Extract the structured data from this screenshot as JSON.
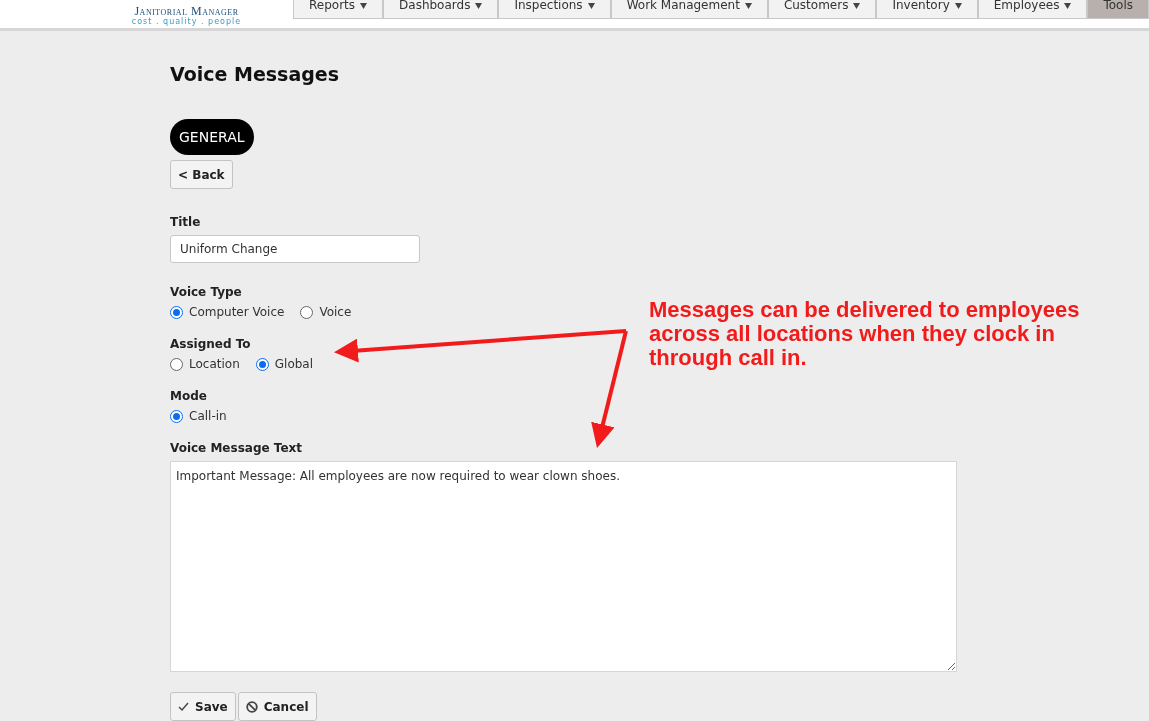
{
  "header": {
    "logo_title": "Janitorial Manager",
    "logo_tagline": "cost . quality . people"
  },
  "nav": [
    {
      "label": "Reports",
      "selected": false,
      "caret": true
    },
    {
      "label": "Dashboards",
      "selected": false,
      "caret": true
    },
    {
      "label": "Inspections",
      "selected": false,
      "caret": true
    },
    {
      "label": "Work Management",
      "selected": false,
      "caret": true
    },
    {
      "label": "Customers",
      "selected": false,
      "caret": true
    },
    {
      "label": "Inventory",
      "selected": false,
      "caret": true
    },
    {
      "label": "Employees",
      "selected": false,
      "caret": true
    },
    {
      "label": "Tools",
      "selected": true,
      "caret": false
    }
  ],
  "page_title": "Voice Messages",
  "section_pill": "GENERAL",
  "back_button": "< Back",
  "form": {
    "title_label": "Title",
    "title_value": "Uniform Change",
    "radio_groups": [
      {
        "label": "Voice Type",
        "options": [
          {
            "label": "Computer Voice",
            "selected": true
          },
          {
            "label": "Voice",
            "selected": false
          }
        ]
      },
      {
        "label": "Assigned To",
        "options": [
          {
            "label": "Location",
            "selected": false
          },
          {
            "label": "Global",
            "selected": true
          }
        ]
      },
      {
        "label": "Mode",
        "options": [
          {
            "label": "Call-in",
            "selected": true
          }
        ]
      }
    ],
    "message_label": "Voice Message Text",
    "message_value": "Important Message: All employees are now required to wear clown shoes."
  },
  "buttons": [
    {
      "label": "Save",
      "kind": "save"
    },
    {
      "label": "Cancel",
      "kind": "cancel"
    }
  ],
  "annotation": {
    "text": "Messages can be delivered to employees across all locations when they clock in through call in."
  }
}
